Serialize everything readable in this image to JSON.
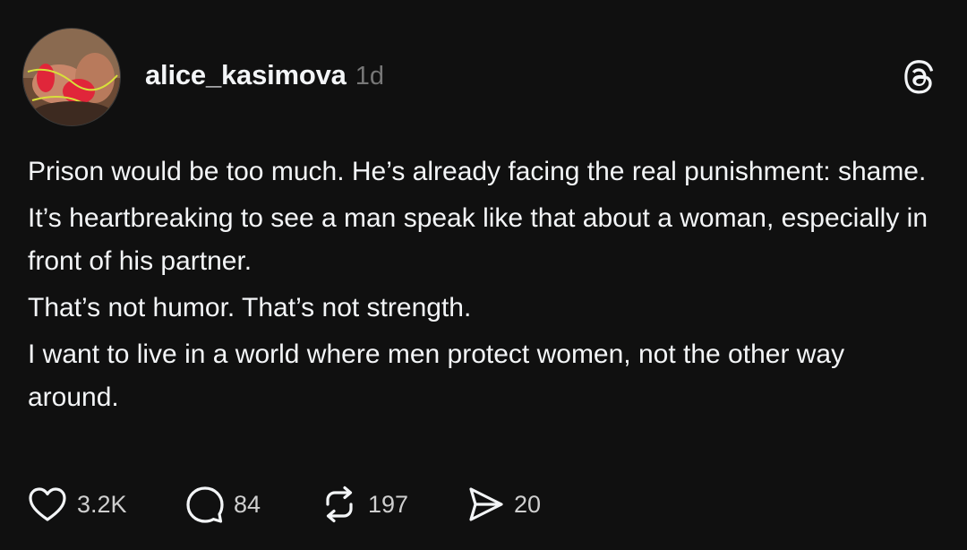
{
  "post": {
    "username": "alice_kasimova",
    "timestamp": "1d",
    "paragraphs": [
      "Prison would be too much. He’s already facing the real punishment: shame.",
      "It’s heartbreaking to see a man speak like that about a woman, especially in front of his partner.",
      "That’s not humor. That’s not strength.",
      "I want to live in a world where men protect women, not the other way around."
    ],
    "actions": {
      "likes": "3.2K",
      "replies": "84",
      "reposts": "197",
      "shares": "20"
    }
  },
  "icons": {
    "app_logo": "threads-logo-icon",
    "like": "heart-icon",
    "reply": "comment-bubble-icon",
    "repost": "repost-icon",
    "share": "send-icon"
  },
  "colors": {
    "background": "#101010",
    "text": "#f3f5f7",
    "muted": "#777777"
  }
}
